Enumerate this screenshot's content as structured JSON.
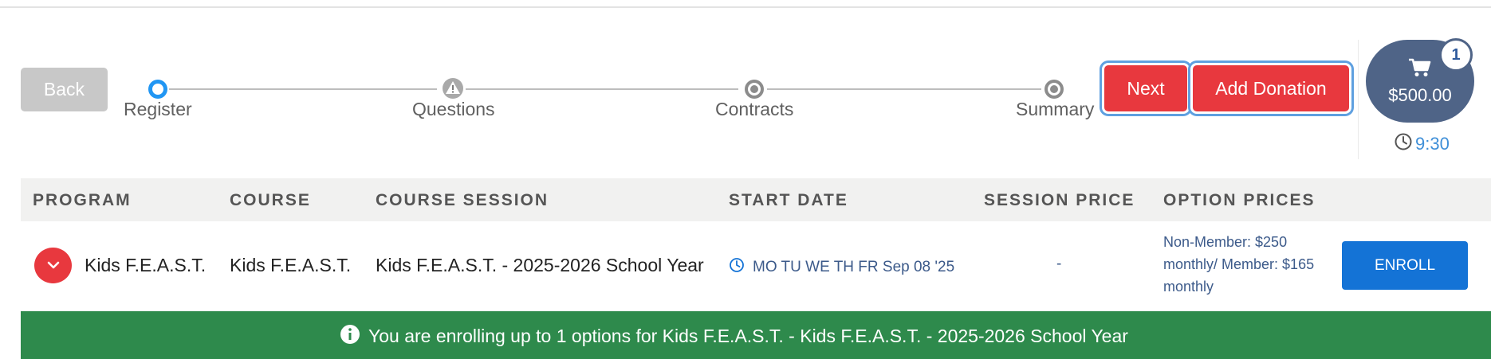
{
  "buttons": {
    "back": "Back",
    "next": "Next",
    "add_donation": "Add Donation",
    "enroll": "ENROLL"
  },
  "steps": [
    {
      "label": "Register",
      "state": "current"
    },
    {
      "label": "Questions",
      "state": "warning"
    },
    {
      "label": "Contracts",
      "state": "pending"
    },
    {
      "label": "Summary",
      "state": "pending"
    }
  ],
  "cart": {
    "total": "$500.00",
    "count": "1",
    "icon": "cart-icon"
  },
  "timer": {
    "value": "9:30",
    "icon": "clock-icon"
  },
  "table": {
    "headers": [
      "PROGRAM",
      "COURSE",
      "COURSE SESSION",
      "START DATE",
      "SESSION PRICE",
      "OPTION PRICES"
    ],
    "rows": [
      {
        "program": "Kids F.E.A.S.T.",
        "course": "Kids F.E.A.S.T.",
        "course_session": "Kids F.E.A.S.T. - 2025-2026 School Year",
        "start_date": "MO TU WE TH FR Sep 08 '25",
        "session_price": "-",
        "option_prices": "Non-Member: $250 monthly/ Member: $165 monthly"
      }
    ]
  },
  "banner": {
    "text": "You are enrolling up to 1 options for Kids F.E.A.S.T. - Kids F.E.A.S.T. - 2025-2026 School Year",
    "icon": "info-icon"
  },
  "colors": {
    "accent_red": "#e8383e",
    "step_blue": "#2196f3",
    "cart_bg": "#4f6487",
    "enroll_blue": "#1473d6",
    "banner_green": "#2e8a4c",
    "timer_blue": "#3f8fd8"
  }
}
